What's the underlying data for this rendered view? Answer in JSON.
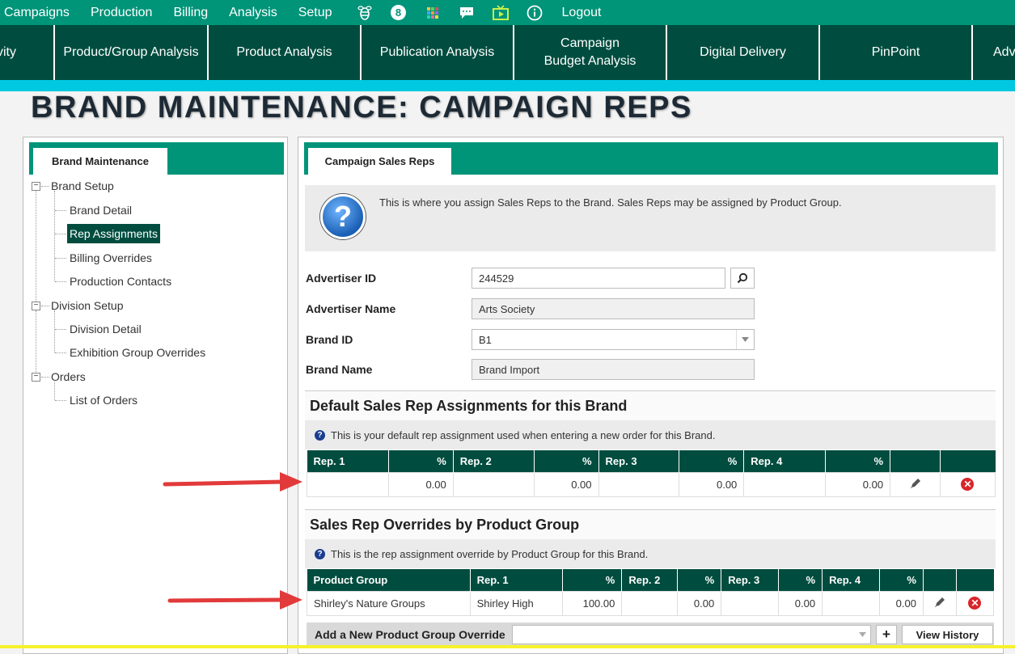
{
  "topnav": {
    "items": [
      "Campaigns",
      "Production",
      "Billing",
      "Analysis",
      "Setup"
    ],
    "badge": "8",
    "logout": "Logout"
  },
  "navtabs": [
    "vity",
    "Product/Group Analysis",
    "Product Analysis",
    "Publication Analysis",
    "Campaign Budget Analysis",
    "Digital Delivery",
    "PinPoint",
    "Adv"
  ],
  "page": {
    "title": "BRAND MAINTENANCE: CAMPAIGN REPS"
  },
  "left": {
    "tab": "Brand Maintenance",
    "tree": [
      {
        "label": "Brand Setup",
        "level": 0
      },
      {
        "label": "Brand Detail",
        "level": 1
      },
      {
        "label": "Rep Assignments",
        "level": 1,
        "selected": true
      },
      {
        "label": "Billing Overrides",
        "level": 1
      },
      {
        "label": "Production Contacts",
        "level": 1
      },
      {
        "label": "Division Setup",
        "level": 0
      },
      {
        "label": "Division Detail",
        "level": 1
      },
      {
        "label": "Exhibition Group Overrides",
        "level": 1
      },
      {
        "label": "Orders",
        "level": 0
      },
      {
        "label": "List of Orders",
        "level": 1
      }
    ]
  },
  "right": {
    "tab": "Campaign Sales Reps",
    "info": "This is where you assign Sales Reps to the Brand. Sales Reps may be assigned by Product Group.",
    "fields": {
      "advertiser_id_label": "Advertiser ID",
      "advertiser_id": "244529",
      "advertiser_name_label": "Advertiser Name",
      "advertiser_name": "Arts Society",
      "brand_id_label": "Brand ID",
      "brand_id": "B1",
      "brand_name_label": "Brand Name",
      "brand_name": "Brand Import"
    },
    "default": {
      "title": "Default Sales Rep Assignments for this Brand",
      "note": "This is your default rep assignment used when entering a new order for this Brand.",
      "headers": [
        "Rep. 1",
        "%",
        "Rep. 2",
        "%",
        "Rep. 3",
        "%",
        "Rep. 4",
        "%"
      ],
      "row": [
        "",
        "0.00",
        "",
        "0.00",
        "",
        "0.00",
        "",
        "0.00"
      ]
    },
    "overrides": {
      "title": "Sales Rep Overrides by Product Group",
      "note": "This is the rep assignment override by Product Group for this Brand.",
      "headers": [
        "Product Group",
        "Rep. 1",
        "%",
        "Rep. 2",
        "%",
        "Rep. 3",
        "%",
        "Rep. 4",
        "%"
      ],
      "row": [
        "Shirley's Nature Groups",
        "Shirley High",
        "100.00",
        "",
        "0.00",
        "",
        "0.00",
        "",
        "0.00"
      ]
    },
    "add": {
      "label": "Add a New Product Group Override",
      "plus": "+",
      "history": "View History"
    }
  },
  "colors": {
    "teal": "#009479",
    "dark": "#004d3f",
    "cyan": "#00c8e0",
    "arrow": "#e23a3a"
  }
}
